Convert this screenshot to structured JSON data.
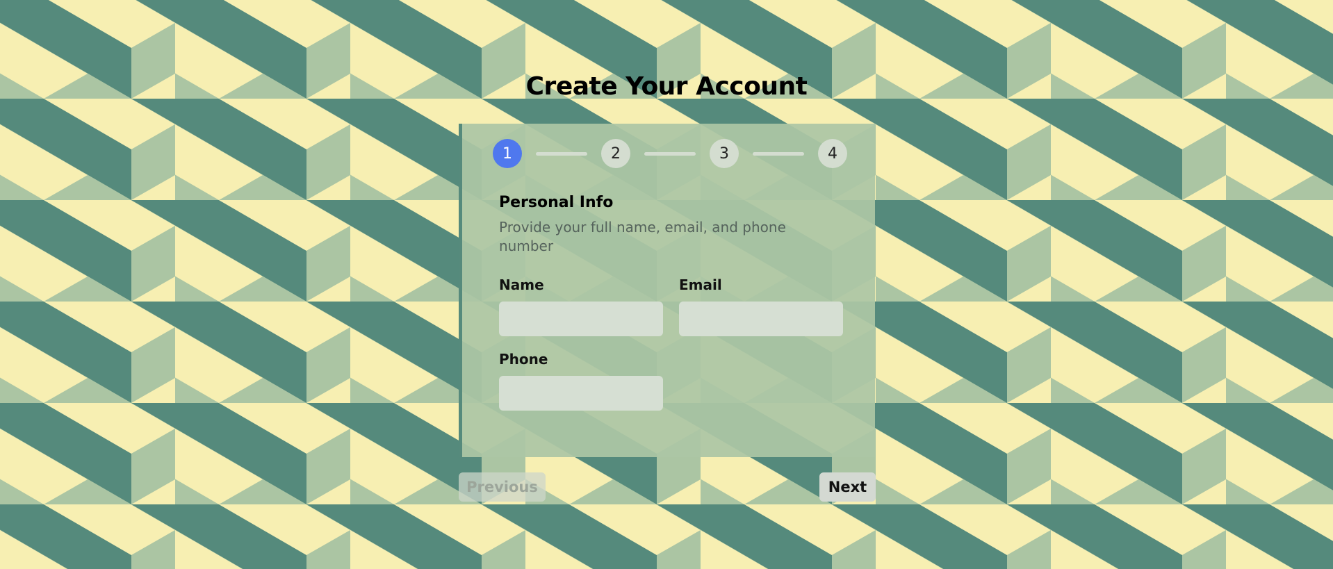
{
  "page": {
    "title": "Create Your Account"
  },
  "colors": {
    "accent": "#4f78ee",
    "pattern_light": "#f7efb2",
    "pattern_mid": "#abc5a3",
    "pattern_dark": "#558a7c",
    "inactive_step": "#d4ddd0"
  },
  "stepper": {
    "current": 1,
    "steps": [
      {
        "label": "1"
      },
      {
        "label": "2"
      },
      {
        "label": "3"
      },
      {
        "label": "4"
      }
    ]
  },
  "section": {
    "title": "Personal Info",
    "description": "Provide your full name, email, and phone number"
  },
  "form": {
    "name_label": "Name",
    "name_value": "",
    "email_label": "Email",
    "email_value": "",
    "phone_label": "Phone",
    "phone_value": ""
  },
  "nav": {
    "previous_label": "Previous",
    "next_label": "Next"
  }
}
